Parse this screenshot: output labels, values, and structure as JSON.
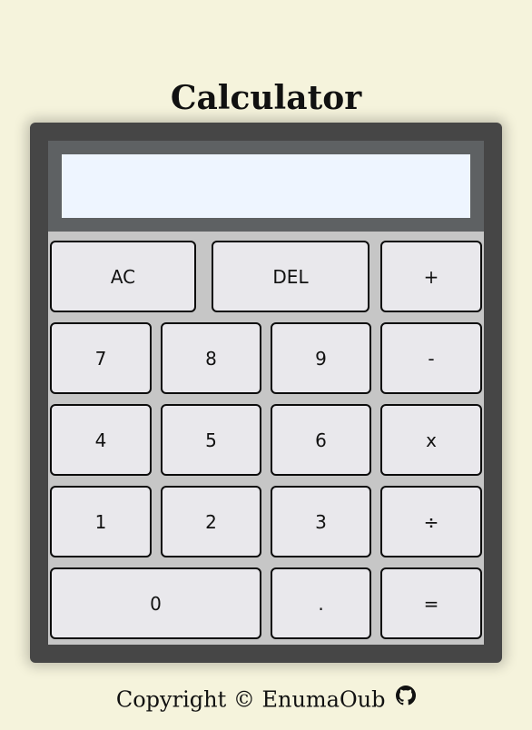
{
  "page": {
    "title": "Calculator"
  },
  "display": {
    "value": ""
  },
  "keys": {
    "ac": "AC",
    "del": "DEL",
    "plus": "+",
    "seven": "7",
    "eight": "8",
    "nine": "9",
    "minus": "-",
    "four": "4",
    "five": "5",
    "six": "6",
    "multiply": "x",
    "one": "1",
    "two": "2",
    "three": "3",
    "divide": "÷",
    "zero": "0",
    "decimal": ".",
    "equals": "="
  },
  "footer": {
    "copyright": "Copyright ©",
    "author": "EnumaOub",
    "icon": "github-icon"
  },
  "colors": {
    "background": "#f5f3dc",
    "calculator_body": "#464646",
    "display_frame": "#5e6163",
    "display_screen": "#eef5ff",
    "keypad": "#c6c6c6",
    "key": "#e9e8ec"
  }
}
